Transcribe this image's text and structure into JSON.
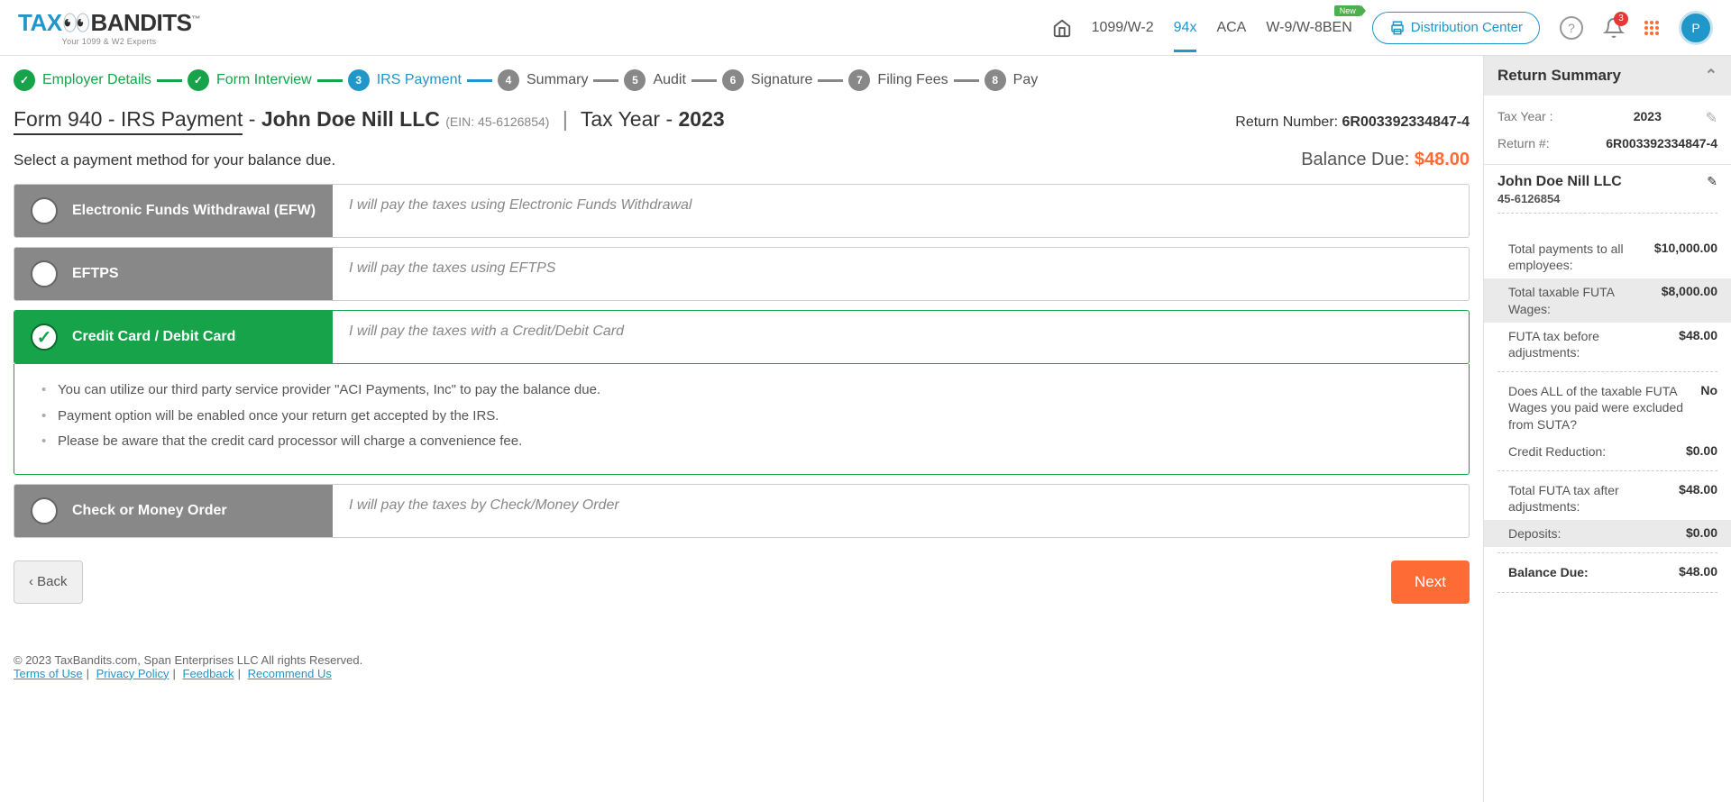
{
  "header": {
    "logo_sub": "Your 1099 & W2 Experts",
    "nav": {
      "nav1": "1099/W-2",
      "nav2": "94x",
      "nav3": "ACA",
      "nav4": "W-9/W-8BEN",
      "new_badge": "New"
    },
    "dist_center": "Distribution Center",
    "notification_count": "3",
    "avatar_initial": "P"
  },
  "steps": {
    "s1": "Employer Details",
    "s2": "Form Interview",
    "s3": "IRS Payment",
    "s4": "Summary",
    "s5": "Audit",
    "s6": "Signature",
    "s7": "Filing Fees",
    "s8": "Pay",
    "n3": "3",
    "n4": "4",
    "n5": "5",
    "n6": "6",
    "n7": "7",
    "n8": "8"
  },
  "page": {
    "form_name": "Form 940 - IRS Payment",
    "dash": " - ",
    "company": "John Doe Nill LLC",
    "ein": "(EIN: 45-6126854)",
    "sep": "|",
    "tax_year_label": "Tax Year -  ",
    "tax_year": "2023",
    "return_num_label": "Return Number: ",
    "return_num": "6R003392334847-4",
    "instruction": "Select a payment method for your balance due.",
    "balance_due_label": "Balance Due: ",
    "balance_due": "$48.00",
    "back": "Back",
    "next": "Next"
  },
  "options": {
    "efw": {
      "name": "Electronic Funds Withdrawal (EFW)",
      "desc": "I will pay the taxes using Electronic Funds Withdrawal"
    },
    "eftps": {
      "name": "EFTPS",
      "desc": "I will pay the taxes using EFTPS"
    },
    "card": {
      "name": "Credit Card / Debit Card",
      "desc": "I will pay the taxes with a Credit/Debit Card"
    },
    "check": {
      "name": "Check or Money Order",
      "desc": "I will pay the taxes by Check/Money Order"
    }
  },
  "card_details": {
    "d1": "You can utilize our third party service provider \"ACI Payments, Inc\" to pay the balance due.",
    "d2": "Payment option will be enabled once your return get accepted by the IRS.",
    "d3": "Please be aware that the credit card processor will charge a convenience fee."
  },
  "footer": {
    "copyright": "© 2023 TaxBandits.com, Span Enterprises LLC All rights Reserved.",
    "terms": "Terms of Use",
    "privacy": "Privacy Policy",
    "feedback": "Feedback",
    "recommend": "Recommend Us"
  },
  "summary": {
    "title": "Return Summary",
    "tax_year_lbl": "Tax Year :",
    "tax_year": "2023",
    "return_lbl": "Return #:",
    "return_num": "6R003392334847-4",
    "company": "John Doe Nill LLC",
    "ein": "45-6126854",
    "rows": {
      "r1l": "Total payments to all employees:",
      "r1v": "$10,000.00",
      "r2l": "Total taxable FUTA Wages:",
      "r2v": "$8,000.00",
      "r3l": "FUTA tax before adjustments:",
      "r3v": "$48.00",
      "r4l": "Does ALL of the taxable FUTA Wages you paid were excluded from SUTA?",
      "r4v": "No",
      "r5l": "Credit Reduction:",
      "r5v": "$0.00",
      "r6l": "Total FUTA tax after adjustments:",
      "r6v": "$48.00",
      "r7l": "Deposits:",
      "r7v": "$0.00",
      "r8l": "Balance Due:",
      "r8v": "$48.00"
    }
  }
}
